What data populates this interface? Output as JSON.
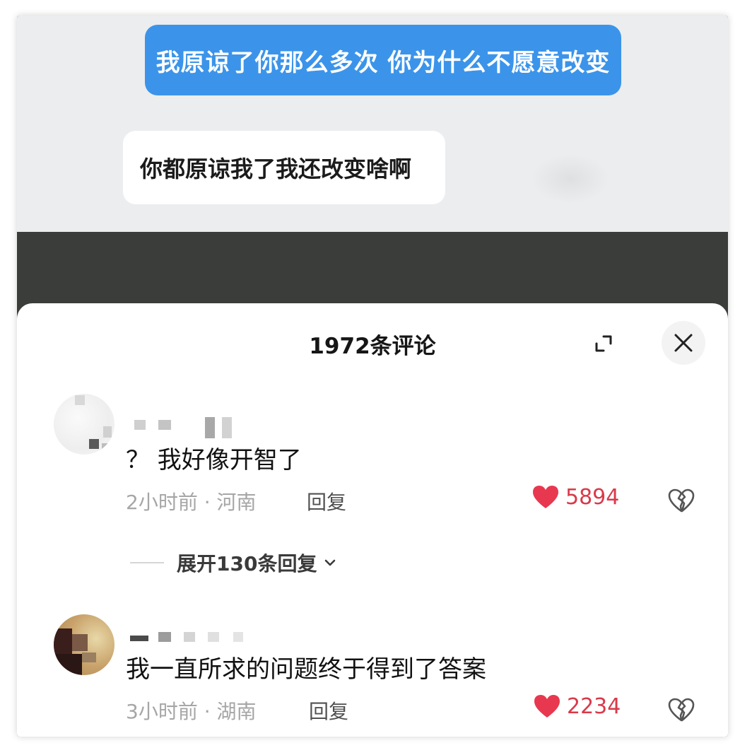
{
  "chat": {
    "my_message": "我原谅了你那么多次 你为什么不愿意改变",
    "their_message": "你都原谅我了我还改变啥啊"
  },
  "comments_panel": {
    "title": "1972条评论",
    "expand_icon": "expand-icon",
    "close_icon": "close-icon"
  },
  "comments": [
    {
      "text": "？ 我好像开智了",
      "meta": "2小时前 · 河南",
      "reply_label": "回复",
      "likes": "5894",
      "like_icon": "heart-filled-icon",
      "dislike_icon": "broken-heart-icon",
      "replies_label": "展开130条回复"
    },
    {
      "text": "我一直所求的问题终于得到了答案",
      "meta": "3小时前 · 湖南",
      "reply_label": "回复",
      "likes": "2234",
      "like_icon": "heart-filled-icon",
      "dislike_icon": "broken-heart-icon"
    }
  ],
  "colors": {
    "my_bubble": "#3b94ea",
    "like": "#e8384f",
    "chat_bg": "#ecedee",
    "divider_band": "#3a3d39"
  }
}
